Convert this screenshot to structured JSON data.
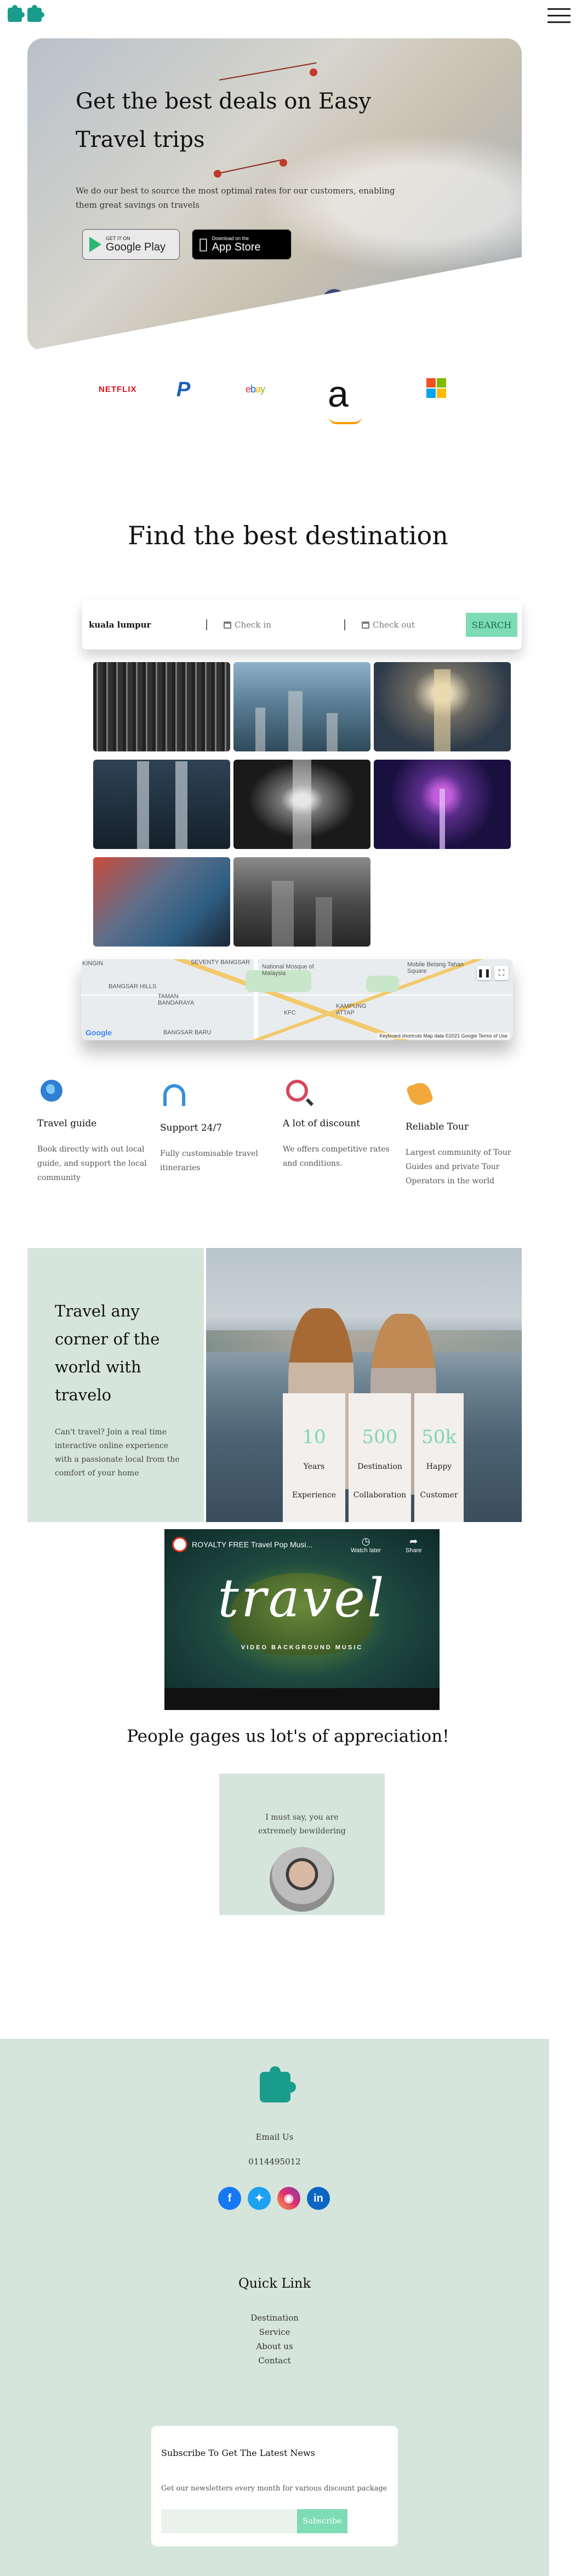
{
  "nav": {
    "menu_icon": "hamburger-icon"
  },
  "hero": {
    "title": "Get the best deals on Easy Travel trips",
    "description": "We do our best to source the most optimal rates for our customers, enabling them great savings on travels",
    "google_play": {
      "small": "GET IT ON",
      "big": "Google Play"
    },
    "app_store": {
      "small": "Download on the",
      "big": "App Store"
    }
  },
  "partners": [
    "NETFLIX",
    "P",
    "ebay",
    "a",
    "Microsoft"
  ],
  "destination": {
    "title": "Find the best destination",
    "search_value": "kuala lumpur",
    "check_in": "Check in",
    "check_out": "Check out",
    "search_button": "SEARCH"
  },
  "map": {
    "labels": [
      "KINGIN",
      "SEVENTY BANGSAR",
      "BANGSAR HILLS",
      "TAMAN BANDARAYA",
      "National Mosque of Malaysia",
      "KAMPUNG ATTAP",
      "Mobile Betang Tahan Square",
      "KFC",
      "BANGSAR BARU"
    ],
    "google": "Google",
    "footer": "Keyboard shortcuts   Map data ©2021 Google   Terms of Use"
  },
  "features": [
    {
      "icon": "globe-icon",
      "title": "Travel guide",
      "text": "Book directly with out local guide, and support the local community"
    },
    {
      "icon": "headphones-icon",
      "title": "Support 24/7",
      "text": "Fully customisable travel itineraries"
    },
    {
      "icon": "search-icon",
      "title": "A lot of discount",
      "text": "We offers competitive rates and conditions."
    },
    {
      "icon": "handshake-icon",
      "title": "Reliable Tour",
      "text": "Largest community of Tour Guides and private Tour Operators in the world"
    }
  ],
  "corner": {
    "title": "Travel any corner of the world with travelo",
    "text": "Can't travel? Join a real time interactive online experience with a passionate local from the comfort of your home",
    "stats": [
      {
        "num": "10",
        "label": "Years Experience"
      },
      {
        "num": "500",
        "label": "Destination Collaboration"
      },
      {
        "num": "50k",
        "label": "Happy Customer"
      }
    ]
  },
  "video": {
    "channel_title": "ROYALTY FREE Travel Pop Musi...",
    "watch_later": "Watch later",
    "share": "Share",
    "big_text": "travel",
    "subtitle": "VIDEO BACKGROUND MUSIC"
  },
  "appreciation": {
    "title": "People gages us lot's of appreciation!",
    "quote": "I must say, you are extremely bewildering"
  },
  "footer": {
    "email_label": "Email Us",
    "phone": "0114495012",
    "social": [
      "facebook-icon",
      "twitter-icon",
      "instagram-icon",
      "linkedin-icon"
    ],
    "quick_link_title": "Quick Link",
    "links": [
      "Destination",
      "Service",
      "About us",
      "Contact"
    ],
    "subscribe_title": "Subscribe To Get The Latest News",
    "subscribe_text": "Get our newsletters every month for various discount package",
    "subscribe_placeholder": "",
    "subscribe_button": "Subscribe"
  }
}
